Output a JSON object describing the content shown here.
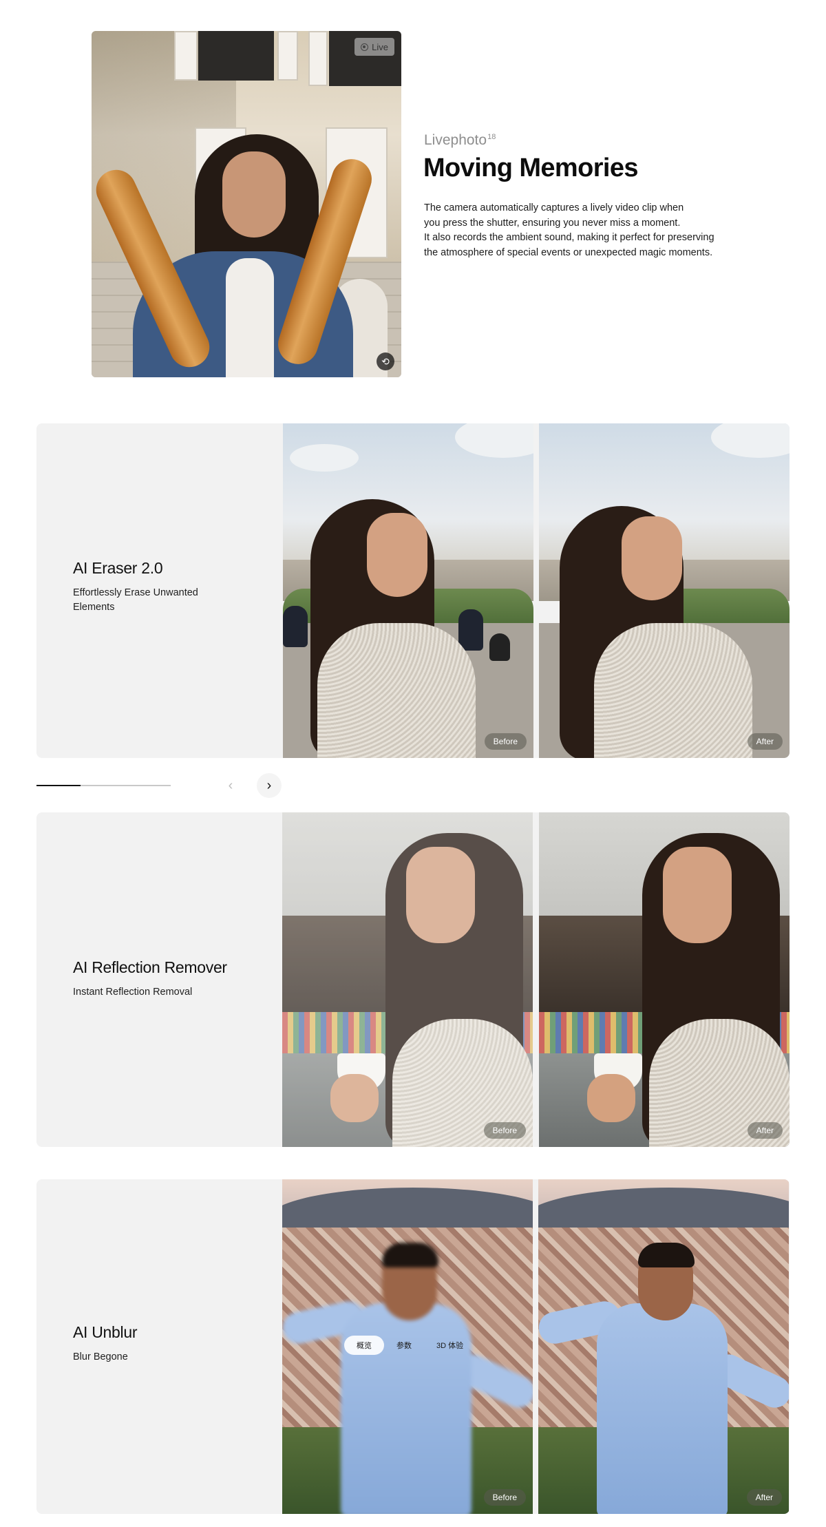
{
  "livephoto": {
    "badge": "Live",
    "eyebrow": "Livephoto",
    "footnote": "18",
    "title": "Moving Memories",
    "description": [
      "The camera automatically captures a lively video clip when",
      "you press the shutter, ensuring you never miss a moment.",
      "It also records the ambient sound, making it perfect for preserving",
      "the atmosphere of special events or unexpected magic moments."
    ],
    "replay_icon": "replay-icon"
  },
  "features": [
    {
      "title": "AI Eraser 2.0",
      "subtitle": "Effortlessly Erase Unwanted Elements",
      "before": "Before",
      "after": "After"
    },
    {
      "title": "AI Reflection Remover",
      "subtitle": "Instant Reflection Removal",
      "before": "Before",
      "after": "After"
    },
    {
      "title": "AI Unblur",
      "subtitle": "Blur Begone",
      "before": "Before",
      "after": "After"
    }
  ],
  "carousel": {
    "progress": 0.33,
    "prev_icon": "‹",
    "next_icon": "›"
  },
  "overlay_tabs": [
    {
      "label": "概览",
      "active": true
    },
    {
      "label": "参数",
      "active": false
    },
    {
      "label": "3D 体验",
      "active": false
    }
  ],
  "colors": {
    "card_bg": "#f2f2f2",
    "text_primary": "#111111",
    "eyebrow_gray": "#8e8e8e"
  }
}
